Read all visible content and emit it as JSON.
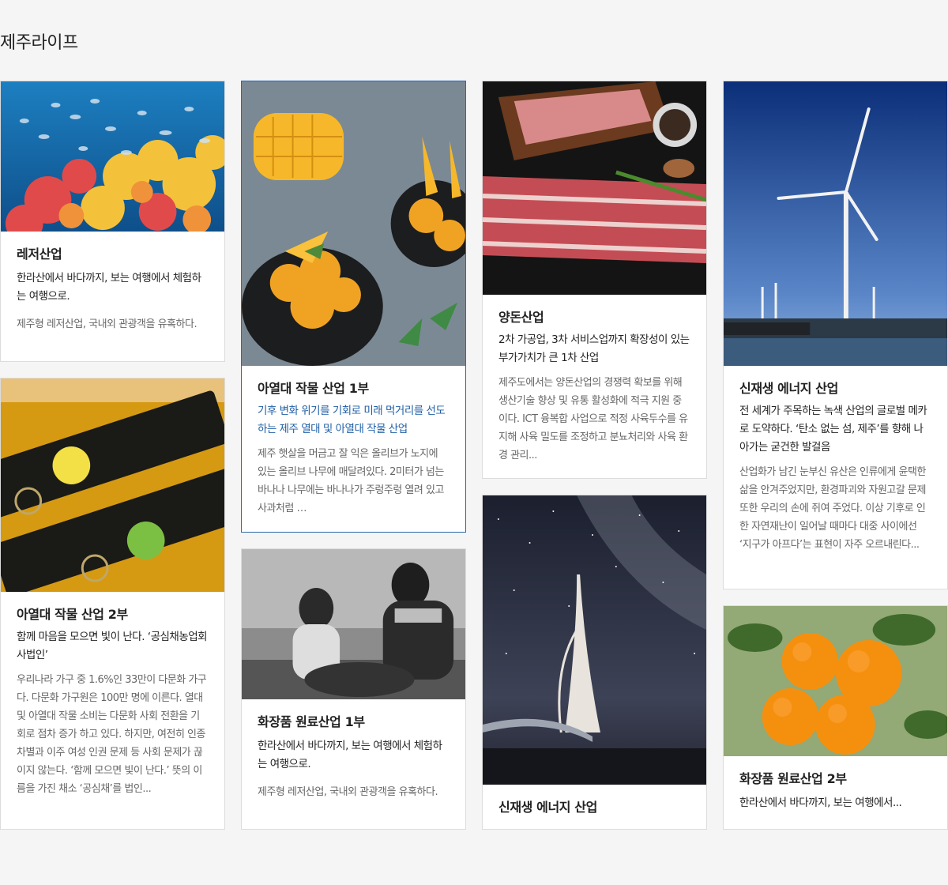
{
  "page": {
    "title": "제주라이프"
  },
  "cards": [
    {
      "title": "레저산업",
      "subtitle": "한라산에서 바다까지, 보는 여행에서 체험하는 여행으로.",
      "desc": "제주형 레저산업, 국내외 관광객을 유혹하다.",
      "image": "undersea-coral-reef"
    },
    {
      "title": "아열대 작물 산업 2부",
      "subtitle": "함께 마음을 모으면 빛이 난다. ‘공심채농업회사법인’",
      "desc": "우리나라 가구 중 1.6%인 33만이 다문화 가구다. 다문화 가구원은 100만 명에 이른다. 열대 및 아열대 작물 소비는 다문화 사회 전환을 기회로 점차 증가 하고 있다. 하지만, 여전히 인종 차별과 이주 여성 인권 문제 등 사회 문제가 끊이지 않는다. ‘함께 모으면 빛이 난다.’ 뜻의 이름을 가진 채소 ‘공심채’를 법인...",
      "image": "lemon-hallabong-bottles"
    },
    {
      "title": "아열대 작물 산업 1부",
      "subtitle": "기후 변화 위기를 기회로 미래 먹거리를 선도하는 제주 열대 및 아열대 작물 산업",
      "desc": "제주 햇살을 머금고 잘 익은 올리브가 노지에 있는 올리브 나무에 매달려있다. 2미터가 넘는 바나나 나무에는 바나나가 주렁주렁 열려 있고 사과처럼 …",
      "image": "mango-sorbet"
    },
    {
      "title": "화장품 원료산업 1부",
      "subtitle": "한라산에서 바다까지, 보는 여행에서 체험하는 여행으로.",
      "desc": "제주형 레저산업, 국내외 관광객을 유혹하다.",
      "image": "haenyeo-with-child"
    },
    {
      "title": "양돈산업",
      "subtitle": "2차 가공업, 3차 서비스업까지 확장성이 있는 부가가치가 큰 1차 산업",
      "desc": "제주도에서는 양돈산업의 경쟁력 확보를 위해 생산기술 향상 및 유통 활성화에 적극 지원 중이다. ICT 융복합 사업으로 적정 사육두수를 유지해 사육 밀도를 조정하고 분뇨처리와 사육 환경 관리...",
      "image": "raw-pork"
    },
    {
      "title": "신재생 에너지 산업",
      "subtitle": "",
      "desc": "",
      "image": "night-bridge-milky-way"
    },
    {
      "title": "신재생 에너지 산업",
      "subtitle": "전 세계가 주목하는 녹색 산업의 글로벌 메카로 도약하다. ‘탄소 없는 섬, 제주’를 향해 나아가는 굳건한 발걸음",
      "desc": "산업화가 남긴 눈부신 유산은 인류에게 윤택한 삶을 안겨주었지만, 환경파괴와 자원고갈 문제 또한 우리의 손에 쥐여 주었다. 이상 기후로 인한 자연재난이 일어날 때마다 대중 사이에선 ‘지구가 아프다’는 표현이 자주 오르내린다...",
      "image": "wind-turbines"
    },
    {
      "title": "화장품 원료산업 2부",
      "subtitle": "한라산에서 바다까지, 보는 여행에서...",
      "desc": "",
      "image": "tangerines"
    }
  ]
}
